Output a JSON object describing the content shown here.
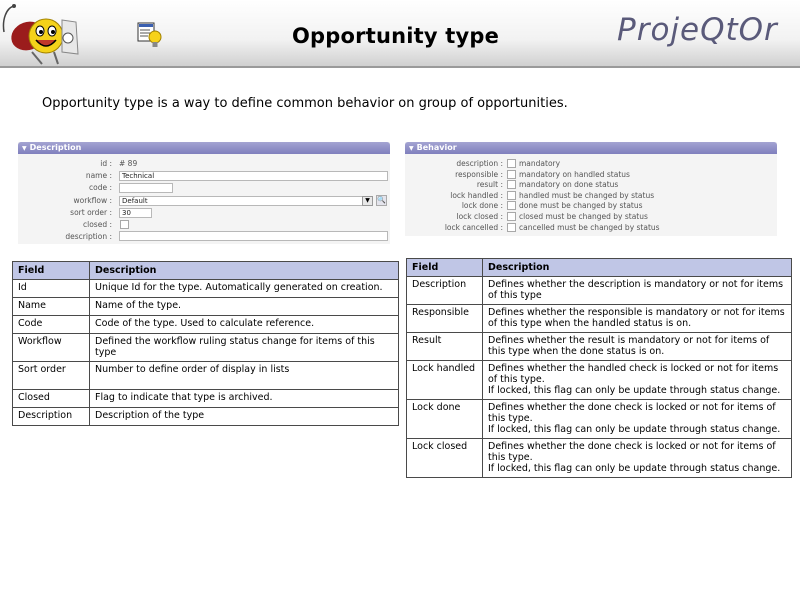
{
  "header": {
    "title": "Opportunity type",
    "brand": "ProjeQtOr"
  },
  "intro": "Opportunity type is a way to define common behavior on group of opportunities.",
  "description_panel": {
    "title": "Description",
    "fields": {
      "id_label": "id :",
      "id_value": "# 89",
      "name_label": "name :",
      "name_value": "Technical",
      "code_label": "code :",
      "workflow_label": "workflow :",
      "workflow_value": "Default",
      "sort_label": "sort order :",
      "sort_value": "30",
      "closed_label": "closed :",
      "description_label": "description :"
    }
  },
  "behavior_panel": {
    "title": "Behavior",
    "rows": [
      {
        "label": "description :",
        "text": "mandatory"
      },
      {
        "label": "responsible :",
        "text": "mandatory on handled status"
      },
      {
        "label": "result :",
        "text": "mandatory on done status"
      },
      {
        "label": "lock handled :",
        "text": "handled must be changed by status"
      },
      {
        "label": "lock done :",
        "text": "done must be changed by status"
      },
      {
        "label": "lock closed :",
        "text": "closed must be changed by status"
      },
      {
        "label": "lock cancelled :",
        "text": "cancelled must be changed by status"
      }
    ]
  },
  "table_left": {
    "headers": [
      "Field",
      "Description"
    ],
    "rows": [
      {
        "field": "Id",
        "desc": "Unique Id for the type. Automatically generated on creation."
      },
      {
        "field": "Name",
        "desc": "Name of the type."
      },
      {
        "field": "Code",
        "desc": "Code of the type. Used to calculate reference."
      },
      {
        "field": "Workflow",
        "desc": "Defined the workflow ruling status change for items of this type"
      },
      {
        "field": "Sort order",
        "desc": "Number to define order of display in lists"
      },
      {
        "field": "Closed",
        "desc": "Flag to indicate that type is archived."
      },
      {
        "field": "Description",
        "desc": "Description of the type"
      }
    ]
  },
  "table_right": {
    "headers": [
      "Field",
      "Description"
    ],
    "rows": [
      {
        "field": "Description",
        "desc": "Defines whether the description is mandatory or not for items of this type",
        "extra": ""
      },
      {
        "field": "Responsible",
        "desc": "Defines whether the responsible is mandatory or not for items of this type when the handled status is on.",
        "extra": ""
      },
      {
        "field": "Result",
        "desc": "Defines whether the result is mandatory or not for items of this type when the done status is on.",
        "extra": ""
      },
      {
        "field": "Lock handled",
        "desc": "Defines whether the handled check is locked or not for items of this type.",
        "extra": "If locked, this flag can only be update through status change."
      },
      {
        "field": "Lock done",
        "desc": "Defines whether the done check is locked or not for items of this type.",
        "extra": "If locked, this flag can only be update through status change."
      },
      {
        "field": "Lock closed",
        "desc": "Defines whether the done check is locked or not for items of this type.",
        "extra": "If locked, this flag can only be update through status change."
      }
    ]
  }
}
